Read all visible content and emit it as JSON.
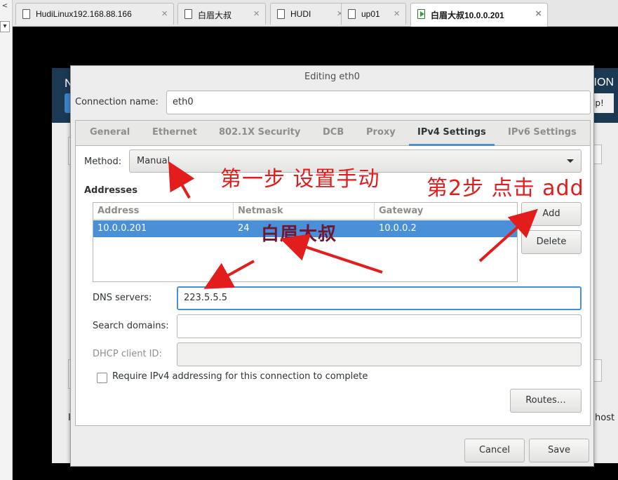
{
  "host_tabs": [
    {
      "label": "HudiLinux192.168.88.166",
      "active": false
    },
    {
      "label": "白眉大叔",
      "active": false
    },
    {
      "label": "HUDI",
      "active": false
    },
    {
      "label": "up01",
      "active": false
    },
    {
      "label": "白眉大叔10.0.0.201",
      "active": true
    }
  ],
  "tab_close_glyph": "×",
  "left_strip": {
    "top_glyph": "<",
    "dropdown_glyph": "▾"
  },
  "background_window": {
    "header_left": "N",
    "header_right": "TION",
    "help_label": "lp!",
    "host_label": "host",
    "left_letter": "I"
  },
  "dialog": {
    "title": "Editing eth0",
    "connection_name_label": "Connection name:",
    "connection_name_value": "eth0",
    "tabs": [
      "General",
      "Ethernet",
      "802.1X Security",
      "DCB",
      "Proxy",
      "IPv4 Settings",
      "IPv6 Settings"
    ],
    "active_tab": "IPv4 Settings",
    "method_label": "Method:",
    "method_value": "Manual",
    "addresses_label": "Addresses",
    "address_columns": [
      "Address",
      "Netmask",
      "Gateway"
    ],
    "address_rows": [
      {
        "address": "10.0.0.201",
        "netmask": "24",
        "gateway": "10.0.0.2"
      }
    ],
    "add_button": "Add",
    "delete_button": "Delete",
    "dns_label": "DNS servers:",
    "dns_value": "223.5.5.5",
    "search_domains_label": "Search domains:",
    "search_domains_value": "",
    "dhcp_client_id_label": "DHCP client ID:",
    "dhcp_client_id_value": "",
    "require_ipv4_label": "Require IPv4 addressing for this connection to complete",
    "require_ipv4_checked": false,
    "routes_button": "Routes…",
    "cancel_button": "Cancel",
    "save_button": "Save"
  },
  "annotations": {
    "step1": "第一步 设置手动",
    "step2": "第2步 点击 add",
    "watermark": "白眉大叔",
    "color": "#e31c1c"
  }
}
